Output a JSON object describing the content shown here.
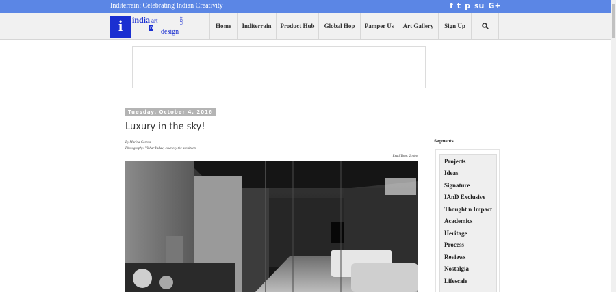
{
  "topbar": {
    "tagline": "Inditerrain: Celebrating Indian Creativity",
    "social": [
      "f",
      "t",
      "p",
      "su",
      "G+"
    ],
    "social_icons": [
      "facebook-icon",
      "twitter-icon",
      "pinterest-icon",
      "stumbleupon-icon",
      "google-plus-icon"
    ]
  },
  "logo": {
    "mark": "i",
    "w1": "india",
    "w2": "art",
    "w3": "n",
    "w4": "design",
    "w5": ".com"
  },
  "nav": {
    "items": [
      "Home",
      "Inditerrain",
      "Product Hub",
      "Global Hop",
      "Pamper Us",
      "Art Gallery",
      "Sign Up"
    ],
    "search_icon": "search-icon"
  },
  "post": {
    "date": "Tuesday, October 4, 2016",
    "title": "Luxury in the sky!",
    "byline": "By Marina Correa",
    "photo_credit": "Photography: Vikhar Yadav; courtesy the architects",
    "read_time": "Read Time: 2 mins"
  },
  "sidebar": {
    "title": "Segments",
    "items": [
      "Projects",
      "Ideas",
      "Signature",
      "IAnD Exclusive",
      "Thought n Impact",
      "Academics",
      "Heritage",
      "Process",
      "Reviews",
      "Nostalgia",
      "Lifescale"
    ]
  },
  "colors": {
    "topbar": "#5b86e5",
    "logo": "#1a2fd1",
    "nav_bg": "#f1f1f1"
  }
}
